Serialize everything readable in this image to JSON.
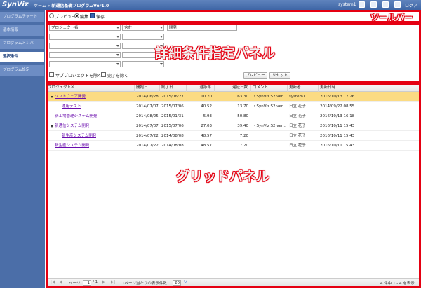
{
  "header": {
    "logo": "SynViz",
    "breadcrumb_home": "ホーム",
    "breadcrumb_sep": "»",
    "breadcrumb_current": "新通信基礎プログラムVer1.0",
    "user": "system1",
    "logout": "ログアウト"
  },
  "sidebar": {
    "items": [
      {
        "label": "プログラムチャート"
      },
      {
        "label": "基本情報"
      },
      {
        "label": "プログラムメンバ"
      },
      {
        "label": "選択条件"
      },
      {
        "label": "プログラム設定"
      }
    ]
  },
  "toolbar": {
    "preview_label": "プレビュー",
    "edit_label": "編集",
    "save_label": "保存",
    "annotation": "ツールバー"
  },
  "conditions": {
    "field_value": "プロジェクト名",
    "operator_value": "含む",
    "text_value": "開発",
    "exclude_sub_label": "サブプロジェクトを除く",
    "exclude_done_label": "完了を除く",
    "preview_button": "プレビュー",
    "reset_button": "リセット",
    "annotation": "詳細条件指定パネル"
  },
  "grid": {
    "annotation": "グリッドパネル",
    "columns": [
      "プロジェクト名",
      "開始日",
      "終了日",
      "進捗率",
      "遅延日数",
      "コメント",
      "更新者",
      "更新日時"
    ],
    "rows": [
      {
        "name": "ソフトウェア開発",
        "start": "2014/06/28",
        "end": "2015/06/27",
        "progress": "10.70",
        "delay": "63.30",
        "comment": "・SynViz S2 ver...",
        "updater": "system1",
        "updated": "2016/10/13 17:26"
      },
      {
        "name": "運用テスト",
        "start": "2014/07/07",
        "end": "2015/07/06",
        "progress": "40.52",
        "delay": "13.70",
        "comment": "・SynViz S2 ver...",
        "updater": "日立 花子",
        "updated": "2014/09/22 08:55"
      },
      {
        "name": "新工場管理システム開発",
        "start": "2014/08/25",
        "end": "2015/01/31",
        "progress": "5.93",
        "delay": "50.80",
        "comment": "",
        "updater": "日立 花子",
        "updated": "2016/10/13 16:18"
      },
      {
        "name": "新通信システム開発",
        "start": "2014/07/07",
        "end": "2015/07/06",
        "progress": "27.03",
        "delay": "39.40",
        "comment": "・SynViz S2 ver...",
        "updater": "日立 花子",
        "updated": "2016/10/11 15:43"
      },
      {
        "name": "新生産システム開発",
        "start": "2014/07/22",
        "end": "2014/08/08",
        "progress": "48.57",
        "delay": "7.20",
        "comment": "",
        "updater": "日立 花子",
        "updated": "2016/10/11 15:43"
      },
      {
        "name": "新生産システム開発",
        "start": "2014/07/22",
        "end": "2014/08/08",
        "progress": "48.57",
        "delay": "7.20",
        "comment": "",
        "updater": "日立 花子",
        "updated": "2016/10/11 15:43"
      }
    ]
  },
  "pager": {
    "page_label": "ページ",
    "page_value": "1",
    "page_total": "/ 1",
    "per_page_label": "1ページ当たりの表示件数",
    "per_page_value": "20",
    "summary": "4 件中 1 - 4 を表示"
  },
  "colors": {
    "annotation_red": "#e50012",
    "selected_row": "#fbdb83",
    "sidebar": "#4b6ea8"
  }
}
